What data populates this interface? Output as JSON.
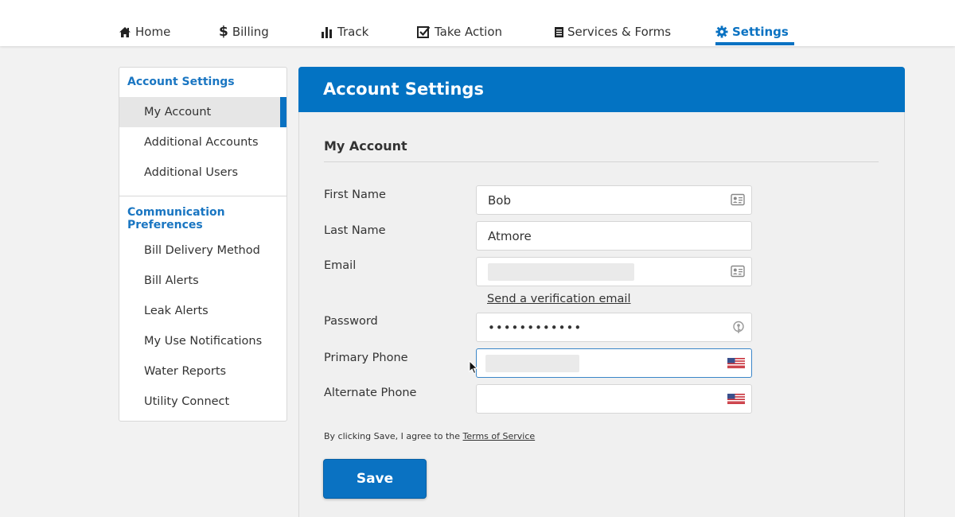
{
  "nav": {
    "items": [
      {
        "label": "Home",
        "icon": "home-icon"
      },
      {
        "label": "Billing",
        "icon": "dollar-icon"
      },
      {
        "label": "Track",
        "icon": "bar-chart-icon"
      },
      {
        "label": "Take Action",
        "icon": "checkbox-icon"
      },
      {
        "label": "Services & Forms",
        "icon": "document-icon"
      },
      {
        "label": "Settings",
        "icon": "gear-icon",
        "active": true
      }
    ],
    "accent_color": "#0a72c2"
  },
  "sidebar": {
    "account_heading": "Account Settings",
    "account_items": [
      {
        "label": "My Account",
        "active": true
      },
      {
        "label": "Additional Accounts"
      },
      {
        "label": "Additional Users"
      }
    ],
    "comm_heading": "Communication Preferences",
    "comm_items": [
      {
        "label": "Bill Delivery Method"
      },
      {
        "label": "Bill Alerts"
      },
      {
        "label": "Leak Alerts"
      },
      {
        "label": "My Use Notifications"
      },
      {
        "label": "Water Reports"
      },
      {
        "label": "Utility Connect"
      }
    ]
  },
  "panel": {
    "title": "Account Settings",
    "section_title": "My Account",
    "header_color": "#0373c3"
  },
  "form": {
    "first_name": {
      "label": "First Name",
      "value": "Bob",
      "icon": "contact-card-icon"
    },
    "last_name": {
      "label": "Last Name",
      "value": "Atmore"
    },
    "email": {
      "label": "Email",
      "value": "",
      "icon": "contact-card-icon"
    },
    "verify_link": "Send a verification email",
    "password": {
      "label": "Password",
      "value": "••••••••••••",
      "icon": "key-icon"
    },
    "primary_phone": {
      "label": "Primary Phone",
      "value": "",
      "icon": "us-flag-icon"
    },
    "alternate_phone": {
      "label": "Alternate Phone",
      "value": "",
      "icon": "us-flag-icon"
    },
    "tos_text": "By clicking Save, I agree to the",
    "tos_link": "Terms of Service",
    "save_label": "Save"
  }
}
